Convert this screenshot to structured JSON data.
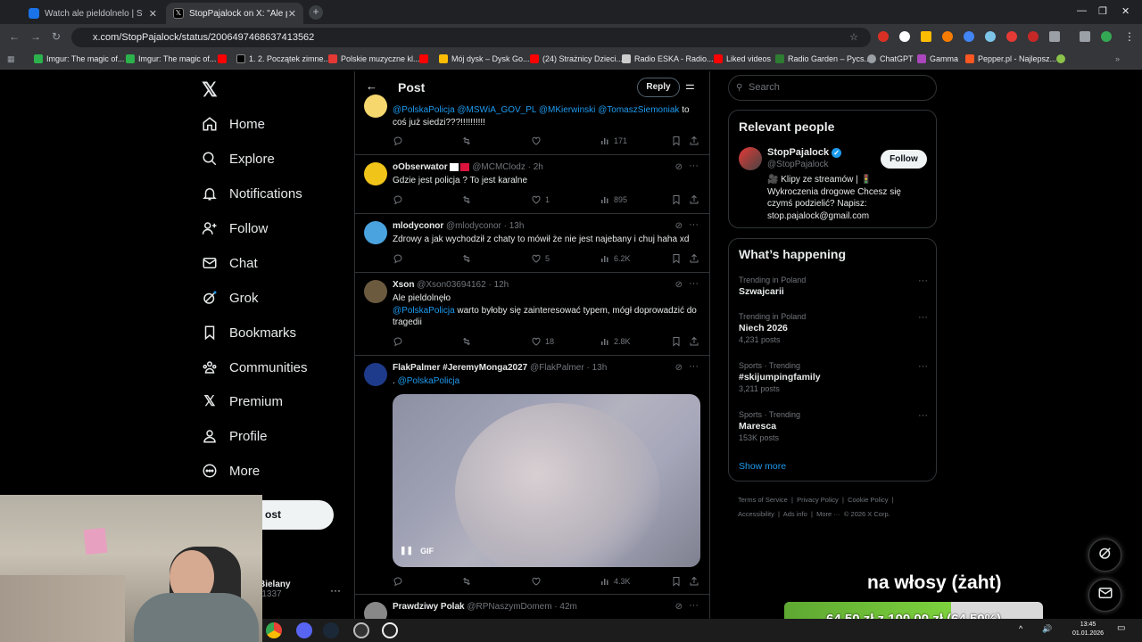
{
  "browser": {
    "tabs": [
      {
        "label": "Watch ale pieldolnelo | Stream",
        "active": false
      },
      {
        "label": "StopPajalock on X: \"Ale pierdo",
        "active": true
      }
    ],
    "url": "x.com/StopPajalock/status/2006497468637413562",
    "bookmarks": [
      "Imgur: The magic of...",
      "Imgur: The magic of...",
      "1. 2. Początek zimne...",
      "Polskie muzyczne kl...",
      "Mój dysk – Dysk Go...",
      "(24) Strażnicy Dzieci...",
      "Radio ESKA - Radio...",
      "Liked videos",
      "Radio Garden – Pycs...",
      "ChatGPT",
      "Gamma",
      "Pepper.pl - Najlepsz..."
    ]
  },
  "nav": {
    "items": [
      "Home",
      "Explore",
      "Notifications",
      "Follow",
      "Chat",
      "Grok",
      "Bookmarks",
      "Communities",
      "Premium",
      "Profile",
      "More"
    ],
    "post_label": "ost",
    "account_name": "Bielany",
    "account_handle": "r1337"
  },
  "header": {
    "title": "Post",
    "reply_label": "Reply"
  },
  "tweets": [
    {
      "text_links": "@PolskaPolicja @MSWiA_GOV_PL @MKierwinski @TomaszSiemoniak",
      "text_plain": " to coś już siedzi???!!!!!!!!!!",
      "views": "171"
    },
    {
      "name": "oObserwator",
      "handle": "@MCMClodz · 2h",
      "text": "Gdzie jest policja ? To jest karalne",
      "likes": "1",
      "views": "895"
    },
    {
      "name": "mlodyconor",
      "handle": "@mlodyconor · 13h",
      "text": "Zdrowy a jak wychodził z chaty to mówił że nie jest najebany i chuj haha xd",
      "likes": "5",
      "views": "6.2K"
    },
    {
      "name": "Xson",
      "handle": "@Xson03694162 · 12h",
      "text1": "Ale pieldolnęło",
      "link": "@PolskaPolicja",
      "text2": " warto byłoby się zainteresować typem, mógł doprowadzić do tragedii",
      "likes": "18",
      "views": "2.8K"
    },
    {
      "name": "FlakPalmer #JeremyMonga2027",
      "handle": "@FlakPalmer · 13h",
      "text_prefix": ".",
      "link": "@PolskaPolicja",
      "gif_label": "GIF",
      "views": "4.3K"
    },
    {
      "name": "Prawdziwy Polak",
      "handle": "@RPNaszymDomem · 42m"
    }
  ],
  "sidebar": {
    "search_placeholder": "Search",
    "relevant_title": "Relevant people",
    "person": {
      "name": "StopPajalock",
      "handle": "@StopPajalock",
      "follow_label": "Follow",
      "bio": "🎥 Klipy ze streamów | 🚦 Wykroczenia drogowe Chcesz się czymś podzielić? Napisz: stop.pajalock@gmail.com"
    },
    "happening_title": "What’s happening",
    "trends": [
      {
        "context": "Trending in Poland",
        "title": "Szwajcarii",
        "posts": ""
      },
      {
        "context": "Trending in Poland",
        "title": "Niech 2026",
        "posts": "4,231 posts"
      },
      {
        "context": "Sports · Trending",
        "title": "#skijumpingfamily",
        "posts": "3,211 posts"
      },
      {
        "context": "Sports · Trending",
        "title": "Maresca",
        "posts": "153K posts"
      }
    ],
    "show_more": "Show more",
    "footer1": "Terms of Service  |  Privacy Policy  |  Cookie Policy  |",
    "footer2": "Accessibility  |  Ads info  |  More ···  © 2026 X Corp."
  },
  "overlay": {
    "donation_text": "na włosy (żaht)",
    "progress_text": "64,50 zł z 100,00 zł (64.50%)",
    "progress_fraction": 0.645,
    "clock_time": "13:45",
    "clock_date": "01.01.2026"
  },
  "colors": {
    "accent": "#1d9bf0",
    "progress": "#7dd13d"
  }
}
